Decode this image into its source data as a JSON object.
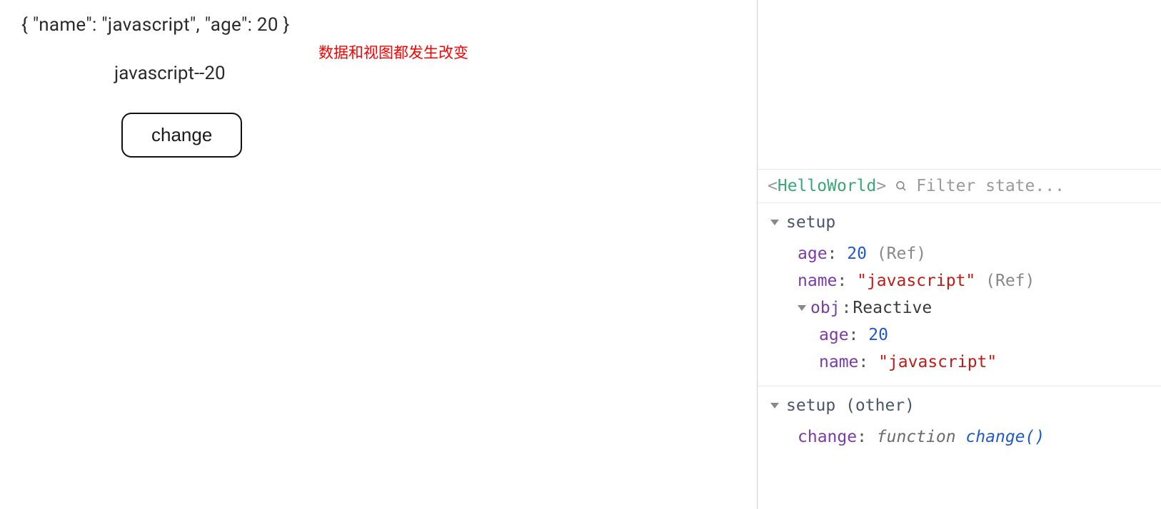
{
  "main": {
    "json_text": "{ \"name\": \"javascript\", \"age\": 20 }",
    "annotation": "数据和视图都发生改变",
    "bound_text": "javascript--20",
    "button_label": "change"
  },
  "devtools": {
    "component_tag": "HelloWorld",
    "filter_placeholder": "Filter state...",
    "sections": {
      "setup": {
        "title": "setup",
        "age_key": "age",
        "age_val": "20",
        "age_tag": "(Ref)",
        "name_key": "name",
        "name_val": "\"javascript\"",
        "name_tag": "(Ref)",
        "obj_key": "obj",
        "obj_type": "Reactive",
        "obj_age_key": "age",
        "obj_age_val": "20",
        "obj_name_key": "name",
        "obj_name_val": "\"javascript\""
      },
      "setup_other": {
        "title": "setup (other)",
        "change_key": "change",
        "fn_kw": "function",
        "fn_name": "change()"
      }
    }
  }
}
